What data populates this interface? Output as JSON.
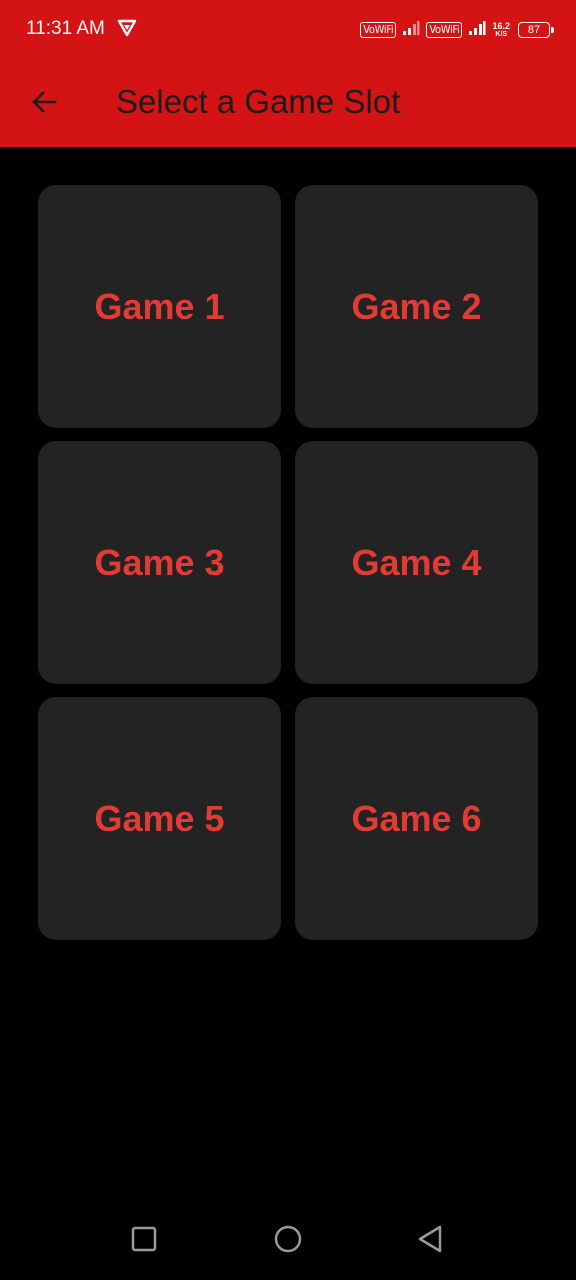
{
  "status_bar": {
    "time": "11:31 AM",
    "wifi_badge_1": "VoWiFi",
    "wifi_badge_2": "VoWiFi",
    "net_speed_value": "16.2",
    "net_speed_unit": "K/S",
    "battery": "87"
  },
  "app_bar": {
    "title": "Select a Game Slot",
    "back_icon": "arrow-left-icon",
    "color": "#d41414"
  },
  "slots": [
    {
      "label": "Game 1"
    },
    {
      "label": "Game 2"
    },
    {
      "label": "Game 3"
    },
    {
      "label": "Game 4"
    },
    {
      "label": "Game 5"
    },
    {
      "label": "Game 6"
    }
  ],
  "colors": {
    "background": "#000000",
    "tile": "#232323",
    "tile_text": "#e23b33"
  },
  "nav_bar": {
    "recents_icon": "square-icon",
    "home_icon": "circle-icon",
    "back_icon": "triangle-back-icon"
  }
}
